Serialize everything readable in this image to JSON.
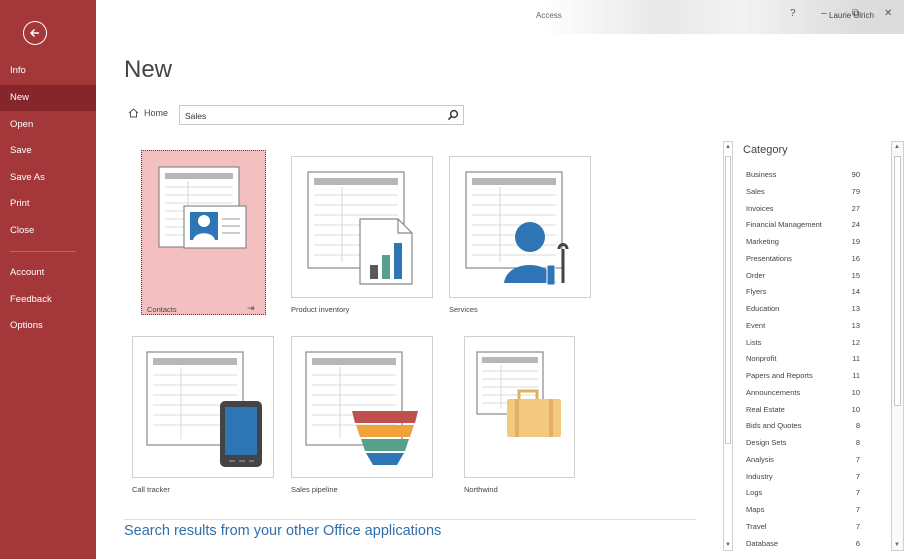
{
  "app": {
    "title": "Access",
    "user": "Laurie Ulrich",
    "help": "?"
  },
  "window": {
    "minimize": "–",
    "restore": "⧉",
    "close": "✕"
  },
  "sidebar": {
    "items": [
      {
        "label": "Info"
      },
      {
        "label": "New",
        "active": true
      },
      {
        "label": "Open"
      },
      {
        "label": "Save"
      },
      {
        "label": "Save As"
      },
      {
        "label": "Print"
      },
      {
        "label": "Close"
      },
      {
        "label": "Account"
      },
      {
        "label": "Feedback"
      },
      {
        "label": "Options"
      }
    ]
  },
  "main": {
    "heading": "New",
    "home_label": "Home",
    "search": {
      "value": "Sales"
    },
    "templates": [
      {
        "label": "Contacts",
        "selected": true,
        "icon": "contacts-template-icon"
      },
      {
        "label": "Product inventory",
        "icon": "product-inventory-template-icon"
      },
      {
        "label": "Services",
        "icon": "services-template-icon"
      },
      {
        "label": "Call tracker",
        "icon": "call-tracker-template-icon"
      },
      {
        "label": "Sales pipeline",
        "icon": "sales-pipeline-template-icon"
      },
      {
        "label": "Northwind",
        "icon": "northwind-template-icon"
      }
    ],
    "other_results": "Search results from your other Office applications"
  },
  "category": {
    "title": "Category",
    "items": [
      {
        "name": "Business",
        "count": "90"
      },
      {
        "name": "Sales",
        "count": "79"
      },
      {
        "name": "Invoices",
        "count": "27"
      },
      {
        "name": "Financial Management",
        "count": "24"
      },
      {
        "name": "Marketing",
        "count": "19"
      },
      {
        "name": "Presentations",
        "count": "16"
      },
      {
        "name": "Order",
        "count": "15"
      },
      {
        "name": "Flyers",
        "count": "14"
      },
      {
        "name": "Education",
        "count": "13"
      },
      {
        "name": "Event",
        "count": "13"
      },
      {
        "name": "Lists",
        "count": "12"
      },
      {
        "name": "Nonprofit",
        "count": "11"
      },
      {
        "name": "Papers and Reports",
        "count": "11"
      },
      {
        "name": "Announcements",
        "count": "10"
      },
      {
        "name": "Real Estate",
        "count": "10"
      },
      {
        "name": "Bids and Quotes",
        "count": "8"
      },
      {
        "name": "Design Sets",
        "count": "8"
      },
      {
        "name": "Analysis",
        "count": "7"
      },
      {
        "name": "Industry",
        "count": "7"
      },
      {
        "name": "Logs",
        "count": "7"
      },
      {
        "name": "Maps",
        "count": "7"
      },
      {
        "name": "Travel",
        "count": "7"
      },
      {
        "name": "Database",
        "count": "6"
      }
    ]
  },
  "colors": {
    "accent": "#a4373a",
    "accent_active": "#85262a",
    "selected_tile": "#f4bfc0",
    "link": "#2f6fad"
  }
}
